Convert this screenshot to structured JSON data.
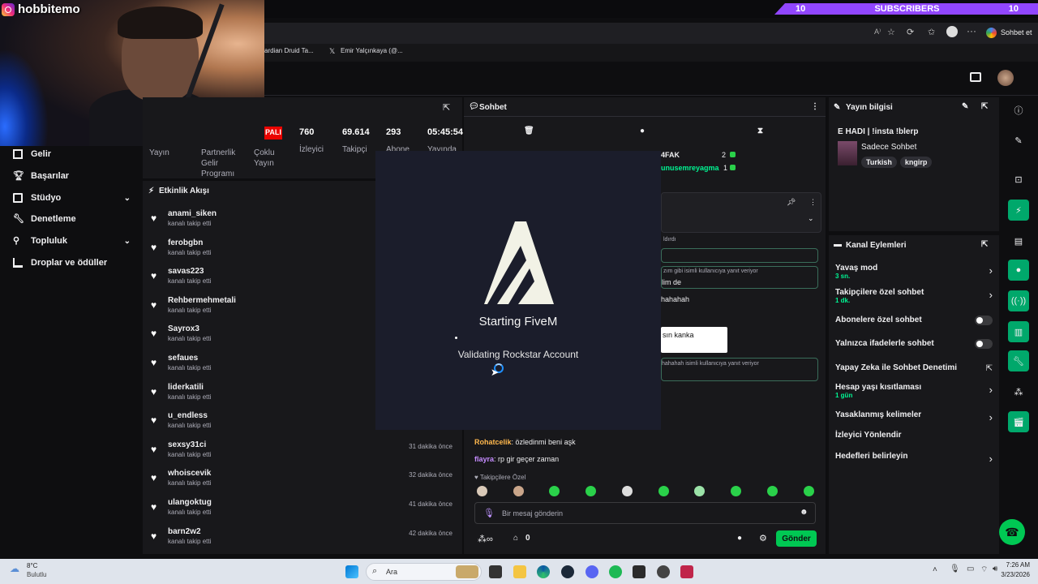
{
  "overlay": {
    "instagram_handle": "hobbitemo",
    "subscribers_left": "10",
    "subscribers_label": "SUBSCRIBERS",
    "subscribers_right": "10"
  },
  "browser": {
    "chat_button": "Sohbet et",
    "bookmarks": [
      "ardian Druid Ta...",
      "Emir Yalçınkaya (@..."
    ]
  },
  "nav": {
    "items": [
      {
        "label": "Gelir",
        "chevron": false
      },
      {
        "label": "Başarılar",
        "chevron": false
      },
      {
        "label": "Stüdyo",
        "chevron": true
      },
      {
        "label": "Denetleme",
        "chevron": false
      },
      {
        "label": "Topluluk",
        "chevron": true
      },
      {
        "label": "Droplar ve ödüller",
        "chevron": false
      }
    ]
  },
  "stats": {
    "live_badge": "PALI",
    "viewers": "760",
    "viewers_label": "İzleyici",
    "followers": "69.614",
    "followers_label": "Takipçi",
    "subs": "293",
    "subs_label": "Abone",
    "uptime": "05:45:54",
    "uptime_label": "Yayında",
    "tabs": [
      "Yayın",
      "Partnerlik Gelir Programı",
      "Çoklu Yayın"
    ]
  },
  "activity": {
    "title": "Etkinlik Akışı",
    "items": [
      {
        "name": "anami_siken",
        "action": "kanalı takip etti",
        "time": ""
      },
      {
        "name": "ferobgbn",
        "action": "kanalı takip etti",
        "time": ""
      },
      {
        "name": "savas223",
        "action": "kanalı takip etti",
        "time": ""
      },
      {
        "name": "Rehbermehmetali",
        "action": "kanalı takip etti",
        "time": ""
      },
      {
        "name": "Sayrox3",
        "action": "kanalı takip etti",
        "time": ""
      },
      {
        "name": "sefaues",
        "action": "kanalı takip etti",
        "time": ""
      },
      {
        "name": "liderkatili",
        "action": "kanalı takip etti",
        "time": ""
      },
      {
        "name": "u_endless",
        "action": "kanalı takip etti",
        "time": ""
      },
      {
        "name": "sexsy31ci",
        "action": "kanalı takip etti",
        "time": "31 dakika önce"
      },
      {
        "name": "whoiscevik",
        "action": "kanalı takip etti",
        "time": "32 dakika önce"
      },
      {
        "name": "ulangoktug",
        "action": "kanalı takip etti",
        "time": "41 dakika önce"
      },
      {
        "name": "barn2w2",
        "action": "kanalı takip etti",
        "time": "42 dakika önce"
      }
    ]
  },
  "chat": {
    "title": "Sohbet",
    "users": [
      {
        "name": "4FAK",
        "count": "2"
      },
      {
        "name": "unusemreyagma",
        "count": "1"
      }
    ],
    "fragments": [
      "ldırdı",
      "zım gibi isimli kullanıcıya yanıt veriyor",
      "lim de",
      "hahahah",
      "sın kanka",
      "hahahah isimli kullanıcıya yanıt veriyor"
    ],
    "messages": [
      {
        "user": "Rohatcelik",
        "text": " özledinmi beni aşk"
      },
      {
        "user": "flayra",
        "text": " rp gir geçer zaman"
      }
    ],
    "followers_only": "Takipçilere Özel",
    "input_placeholder": "Bir mesaj gönderin",
    "points": "0",
    "send_button": "Gönder"
  },
  "fivem": {
    "title": "Starting FiveM",
    "status": "Validating Rockstar Account"
  },
  "stream_info": {
    "title": "Yayın bilgisi",
    "stream_title": "E HADI | !insta !blerp",
    "category": "Sadece Sohbet",
    "tags": [
      "Turkish",
      "kngirp"
    ]
  },
  "channel_actions": {
    "title": "Kanal Eylemleri",
    "items": [
      {
        "label": "Yavaş mod",
        "sub": "3 sn.",
        "control": "chevron"
      },
      {
        "label": "Takipçilere özel sohbet",
        "sub": "1 dk.",
        "control": "chevron"
      },
      {
        "label": "Abonelere özel sohbet",
        "sub": "",
        "control": "toggle"
      },
      {
        "label": "Yalnızca ifadelerle sohbet",
        "sub": "",
        "control": "toggle"
      },
      {
        "label": "Yapay Zeka ile Sohbet Denetimi",
        "sub": "",
        "control": "external"
      },
      {
        "label": "Hesap yaşı kısıtlaması",
        "sub": "1 gün",
        "control": "chevron"
      },
      {
        "label": "Yasaklanmış kelimeler",
        "sub": "",
        "control": "chevron"
      },
      {
        "label": "İzleyici Yönlendir",
        "sub": "",
        "control": "none"
      },
      {
        "label": "Hedefleri belirleyin",
        "sub": "",
        "control": "chevron"
      }
    ]
  },
  "taskbar": {
    "weather_temp": "8°C",
    "weather_desc": "Bulutlu",
    "search_label": "Ara",
    "time": "7:26 AM",
    "date": "3/23/2026"
  },
  "colors": {
    "twitch_purple": "#9146ff",
    "send_green": "#00c853",
    "live_red": "#eb0400",
    "fivem_bg": "#1b1d2b"
  }
}
